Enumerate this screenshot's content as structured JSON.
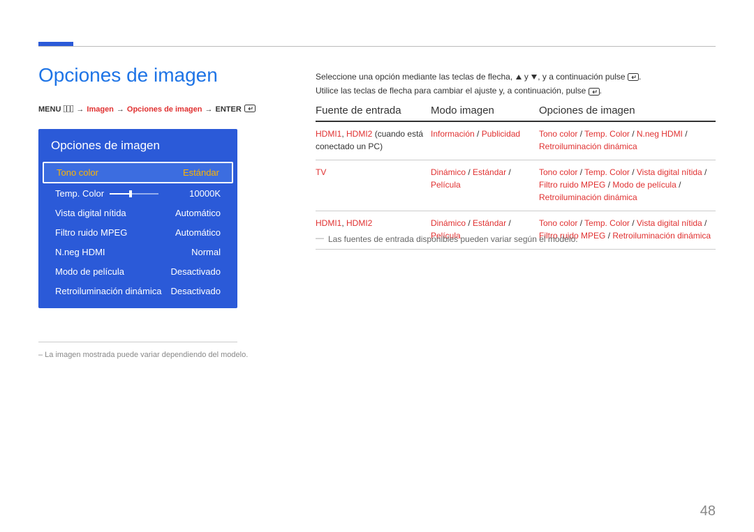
{
  "page": {
    "title": "Opciones de imagen",
    "number": "48"
  },
  "breadcrumb": {
    "prefix": "MENU",
    "parts": [
      "Imagen",
      "Opciones de imagen"
    ],
    "suffix": "ENTER"
  },
  "menu_panel": {
    "title": "Opciones de imagen",
    "items": [
      {
        "label": "Tono color",
        "value": "Estándar",
        "highlight": true
      },
      {
        "label": "Temp. Color",
        "value": "10000K",
        "slider": true
      },
      {
        "label": "Vista digital nítida",
        "value": "Automático"
      },
      {
        "label": "Filtro ruido MPEG",
        "value": "Automático"
      },
      {
        "label": "N.neg HDMI",
        "value": "Normal"
      },
      {
        "label": "Modo de película",
        "value": "Desactivado"
      },
      {
        "label": "Retroiluminación dinámica",
        "value": "Desactivado"
      }
    ]
  },
  "caption": "–  La imagen mostrada puede variar dependiendo del modelo.",
  "intro": {
    "line1_a": "Seleccione una opción mediante las teclas de flecha, ",
    "line1_b": " y ",
    "line1_c": ", y a continuación pulse ",
    "line1_d": ".",
    "line2_a": "Utilice las teclas de flecha para cambiar el ajuste y, a continuación, pulse ",
    "line2_b": "."
  },
  "table": {
    "headers": {
      "c1": "Fuente de entrada",
      "c2": "Modo imagen",
      "c3": "Opciones de imagen"
    },
    "rows": [
      {
        "c1": [
          {
            "t": "HDMI1",
            "hl": true
          },
          {
            "t": ", "
          },
          {
            "t": "HDMI2",
            "hl": true
          },
          {
            "t": " (cuando está conectado un PC)"
          }
        ],
        "c2": [
          {
            "t": "Información",
            "hl": true
          },
          {
            "t": " / "
          },
          {
            "t": "Publicidad",
            "hl": true
          }
        ],
        "c3": [
          {
            "t": "Tono color",
            "hl": true
          },
          {
            "t": " / "
          },
          {
            "t": "Temp. Color",
            "hl": true
          },
          {
            "t": " / "
          },
          {
            "t": "N.neg HDMI",
            "hl": true
          },
          {
            "t": " / "
          },
          {
            "t": "Retroiluminación dinámica",
            "hl": true
          }
        ]
      },
      {
        "c1": [
          {
            "t": "TV",
            "hl": true
          }
        ],
        "c2": [
          {
            "t": "Dinámico",
            "hl": true
          },
          {
            "t": " / "
          },
          {
            "t": "Estándar",
            "hl": true
          },
          {
            "t": " / "
          },
          {
            "t": "Película",
            "hl": true
          }
        ],
        "c3": [
          {
            "t": "Tono color",
            "hl": true
          },
          {
            "t": " / "
          },
          {
            "t": "Temp. Color",
            "hl": true
          },
          {
            "t": " / "
          },
          {
            "t": "Vista digital nítida",
            "hl": true
          },
          {
            "t": " / "
          },
          {
            "t": "Filtro ruido MPEG",
            "hl": true
          },
          {
            "t": " / "
          },
          {
            "t": "Modo de película",
            "hl": true
          },
          {
            "t": " / "
          },
          {
            "t": "Retroiluminación dinámica",
            "hl": true
          }
        ]
      },
      {
        "c1": [
          {
            "t": "HDMI1",
            "hl": true
          },
          {
            "t": ", "
          },
          {
            "t": "HDMI2",
            "hl": true
          }
        ],
        "c2": [
          {
            "t": "Dinámico",
            "hl": true
          },
          {
            "t": " / "
          },
          {
            "t": "Estándar",
            "hl": true
          },
          {
            "t": " / "
          },
          {
            "t": "Película",
            "hl": true
          }
        ],
        "c3": [
          {
            "t": "Tono color",
            "hl": true
          },
          {
            "t": " / "
          },
          {
            "t": "Temp. Color",
            "hl": true
          },
          {
            "t": " / "
          },
          {
            "t": "Vista digital nítida",
            "hl": true
          },
          {
            "t": " / "
          },
          {
            "t": "Filtro ruido MPEG",
            "hl": true
          },
          {
            "t": " / "
          },
          {
            "t": "Retroiluminación dinámica",
            "hl": true
          }
        ]
      }
    ]
  },
  "footnote": "Las fuentes de entrada disponibles pueden variar según el modelo."
}
